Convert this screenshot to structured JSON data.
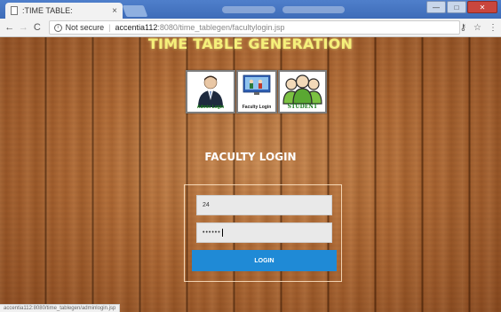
{
  "browser": {
    "tab_title": ":TIME TABLE:",
    "tab_close": "×",
    "security_label": "Not secure",
    "url_host": "accentia112",
    "url_path": ":8080/time_tablegen/facultylogin.jsp",
    "status_url": "accentia112:8080/time_tablegen/adminlogin.jsp",
    "nav": {
      "back": "←",
      "forward": "→",
      "reload": "C"
    },
    "right_icons": {
      "key": "⚷",
      "star": "☆",
      "menu": "⋮"
    },
    "window_buttons": {
      "minimize": "—",
      "maximize": "□",
      "close": "✕"
    }
  },
  "page": {
    "title": "TIME TABLE GENERATION",
    "roles": [
      {
        "label": "Admin Login",
        "icon": "admin-person-icon"
      },
      {
        "label": "Faculty Login",
        "icon": "faculty-computer-icon"
      },
      {
        "label": "STUDENT",
        "icon": "students-group-icon"
      }
    ],
    "login_heading": "FACULTY LOGIN",
    "form": {
      "user_id_value": "24",
      "password_value": "••••••",
      "login_button": "LOGIN"
    }
  },
  "colors": {
    "title_yellow": "#f5f07a",
    "login_button_blue": "#1f8ad6",
    "wood_brown": "#b06a35"
  }
}
